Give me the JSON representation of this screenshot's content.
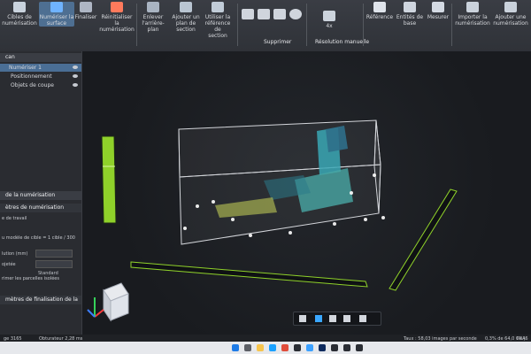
{
  "ribbon": {
    "buttons": [
      {
        "label": "Cibles de\nnumérisation",
        "icon": "targets-icon"
      },
      {
        "label": "Numériser la\nsurface",
        "icon": "scan-surface-icon",
        "active": true
      },
      {
        "label": "Finaliser",
        "icon": "finalize-icon"
      },
      {
        "label": "Réinitialiser la\nnumérisation",
        "icon": "reset-scan-icon"
      },
      {
        "label": "Enlever\nl'arrière-plan",
        "icon": "remove-background-icon"
      },
      {
        "label": "Ajouter un\nplan de\nsection",
        "icon": "add-section-plane-icon"
      },
      {
        "label": "Utiliser la\nréférence de\nsection",
        "icon": "use-section-reference-icon"
      },
      {
        "label": "Référence",
        "icon": "reference-icon"
      },
      {
        "label": "Entités de\nbase",
        "icon": "base-entities-icon"
      },
      {
        "label": "Mesurer",
        "icon": "measure-icon"
      },
      {
        "label": "Importer la\nnumérisation",
        "icon": "import-scan-icon"
      },
      {
        "label": "Ajouter une\nnumérisation",
        "icon": "add-scan-icon"
      }
    ],
    "groups": {
      "supprimer": "Supprimer",
      "resolution": "Résolution manuelle"
    },
    "resolution_value": "4x"
  },
  "sidebar": {
    "header": "can",
    "items": [
      "Numériser 1",
      "Positionnement",
      "Objets de coupe"
    ],
    "panel_title": "de la numérisation",
    "panel_sub": "ètres de numérisation",
    "workspace": "e de travail",
    "target_model": "u modèle de cible = 1 cible / 300",
    "resolution_label": "lution (mm)",
    "resolution_value": "100",
    "projected_label": "ojetée",
    "projected_value": "Standard",
    "remove_patches": "rimer les parcelles isolées",
    "finalization_title": "mètres de finalisation de la"
  },
  "status": {
    "left": "ge 3165",
    "obturator": "Obturateur 2,28 ms",
    "rate": "Taux : 58,03 images par seconde",
    "memory": "0,3% de 64,0 Go (6",
    "language": "FRA"
  },
  "colors": {
    "accent": "#8fd12a",
    "selection": "#4e6f92"
  }
}
